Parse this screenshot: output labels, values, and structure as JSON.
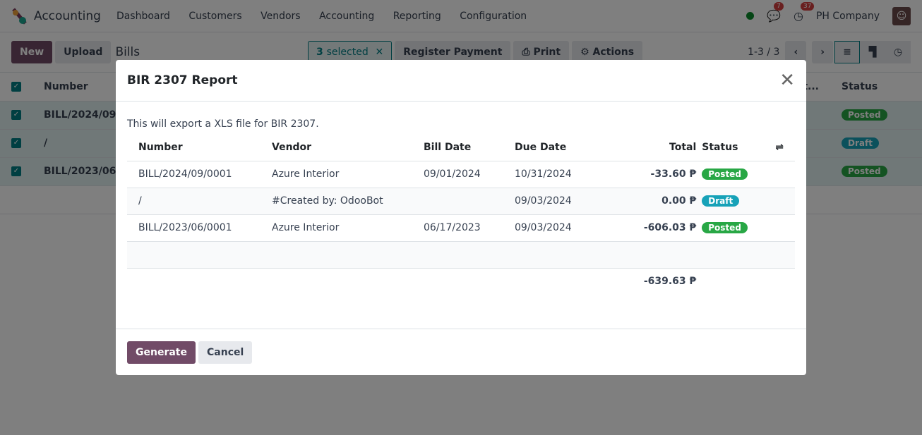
{
  "nav": {
    "app": "Accounting",
    "menu": [
      "Dashboard",
      "Customers",
      "Vendors",
      "Accounting",
      "Reporting",
      "Configuration"
    ],
    "messages": "7",
    "activities": "37",
    "company": "PH Company"
  },
  "cp": {
    "new": "New",
    "upload": "Upload",
    "title": "Bills",
    "selected_count": "3",
    "selected_label": "selected",
    "register": "Register Payment",
    "print": "Print",
    "actions": "Actions",
    "pager": "1-3 / 3"
  },
  "list": {
    "headers": {
      "number": "Number",
      "pay_status": "... stat...",
      "status": "Status"
    },
    "rows": [
      {
        "number": "BILL/2024/09/...",
        "status": "Posted"
      },
      {
        "number": "/",
        "status": "Draft"
      },
      {
        "number": "BILL/2023/06/...",
        "status": "Posted"
      }
    ]
  },
  "modal": {
    "title": "BIR 2307 Report",
    "intro": "This will export a XLS file for BIR 2307.",
    "headers": {
      "number": "Number",
      "vendor": "Vendor",
      "bill_date": "Bill Date",
      "due_date": "Due Date",
      "total": "Total",
      "status": "Status"
    },
    "rows": [
      {
        "number": "BILL/2024/09/0001",
        "vendor": "Azure Interior",
        "bill_date": "09/01/2024",
        "due_date": "10/31/2024",
        "total": "-33.60 ₱",
        "status": "Posted"
      },
      {
        "number": "/",
        "vendor": "#Created by: OdooBot",
        "bill_date": "",
        "due_date": "09/03/2024",
        "total": "0.00 ₱",
        "status": "Draft"
      },
      {
        "number": "BILL/2023/06/0001",
        "vendor": "Azure Interior",
        "bill_date": "06/17/2023",
        "due_date": "09/03/2024",
        "total": "-606.03 ₱",
        "status": "Posted"
      }
    ],
    "grand_total": "-639.63 ₱",
    "generate": "Generate",
    "cancel": "Cancel"
  },
  "colors": {
    "primary": "#714b67",
    "teal": "#017e84",
    "posted": "#28a745",
    "draft": "#17a2b8"
  }
}
